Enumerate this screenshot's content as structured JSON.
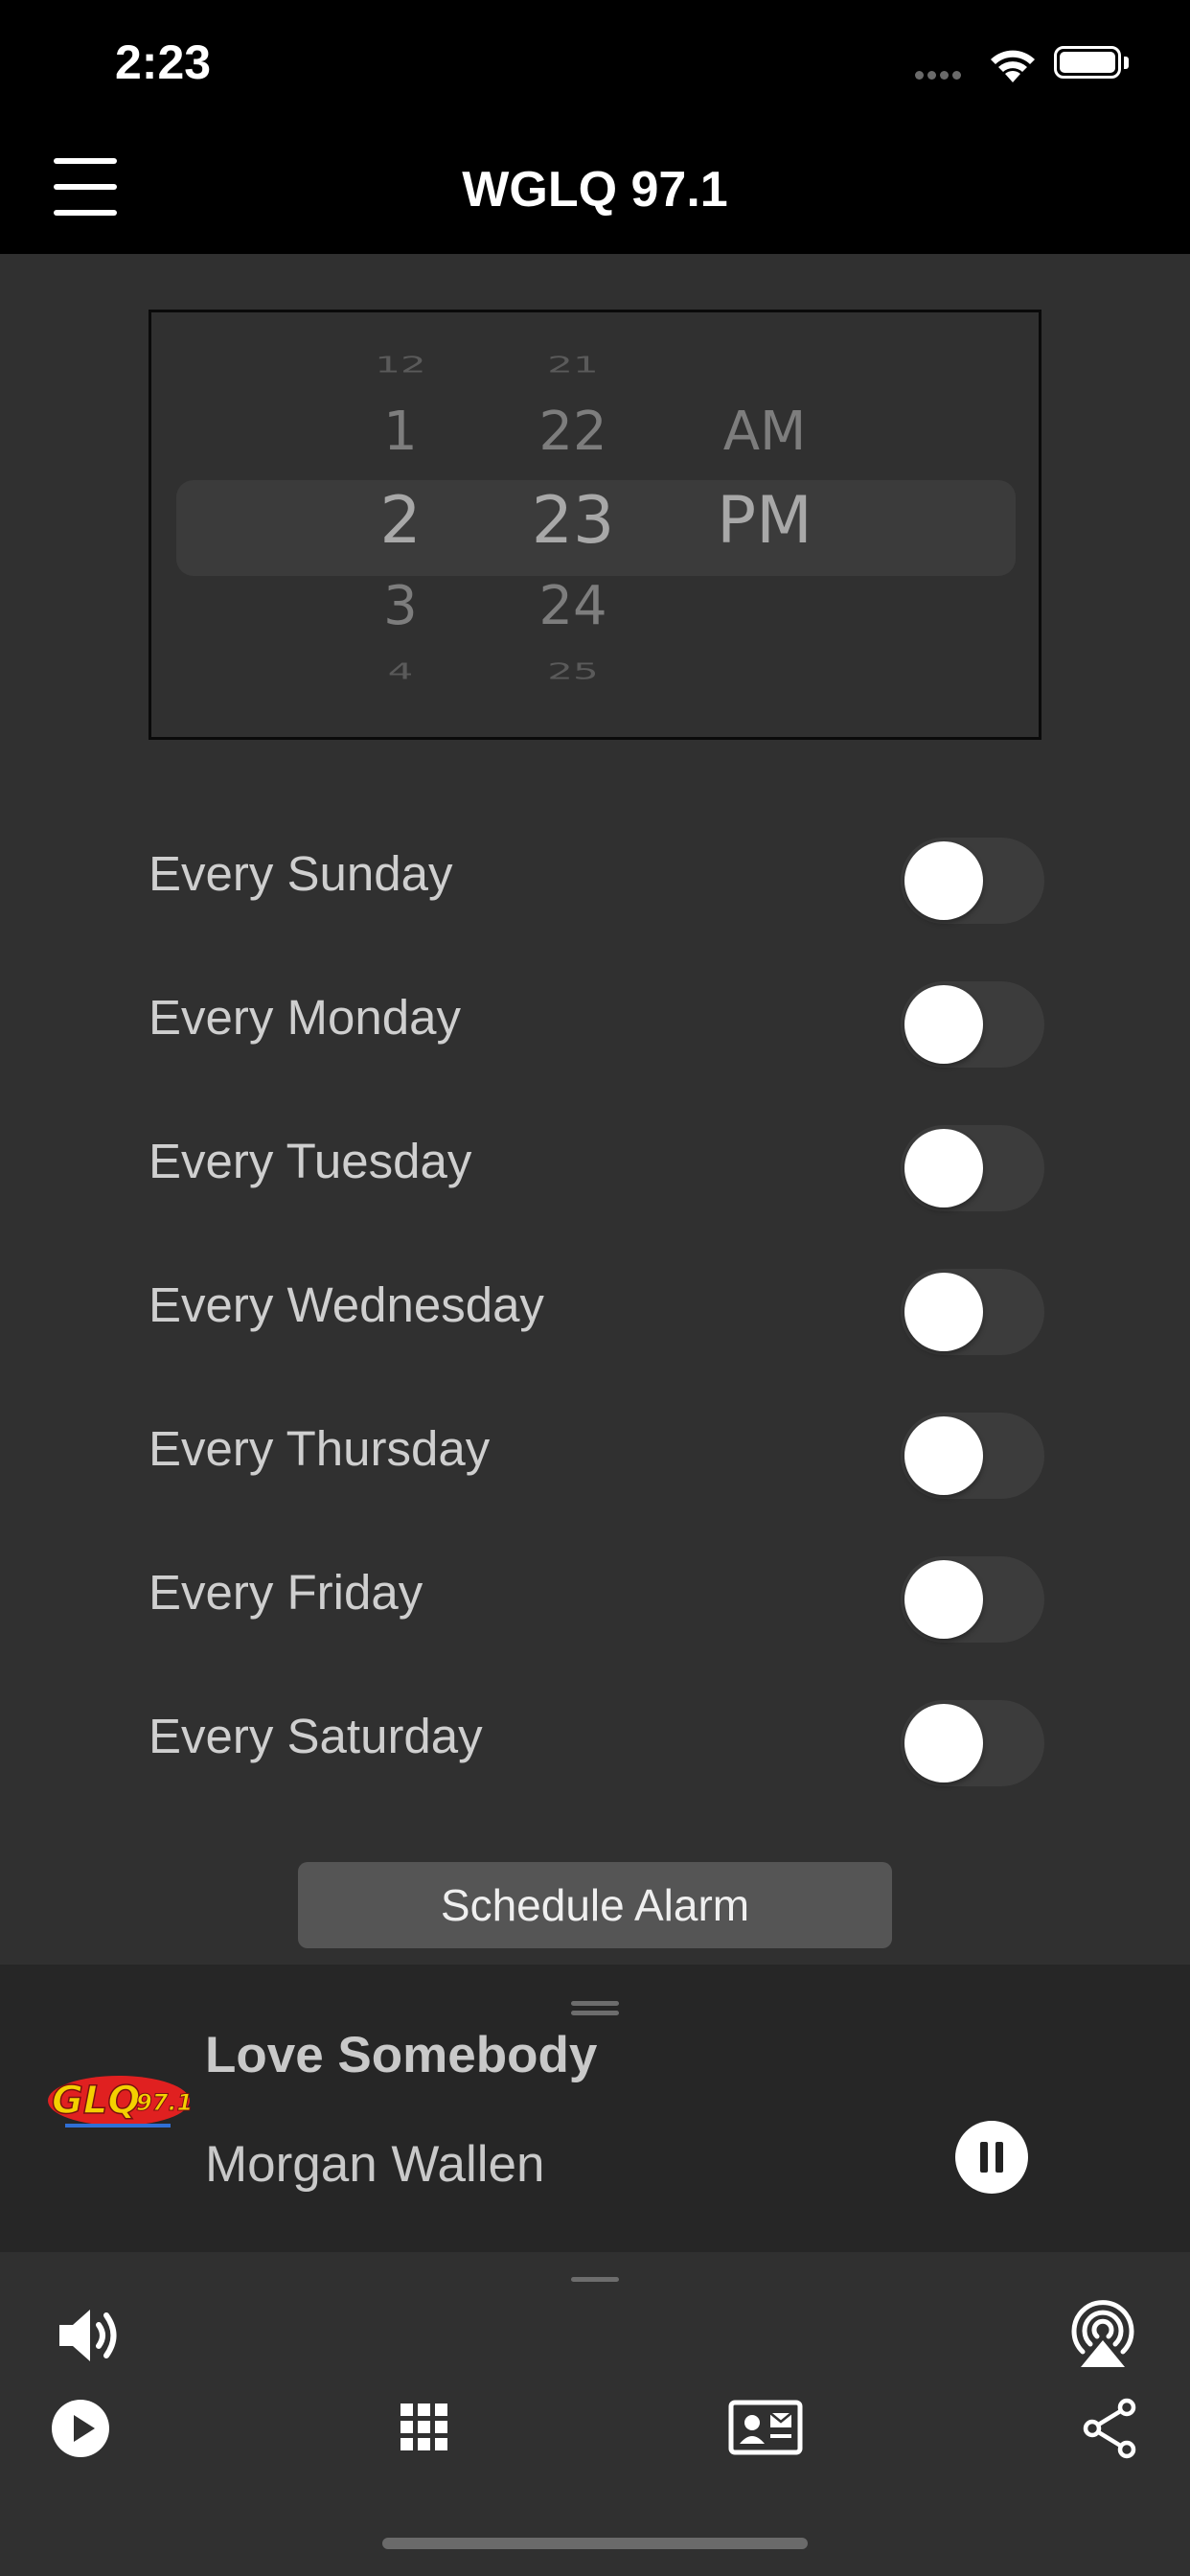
{
  "status_bar": {
    "time": "2:23"
  },
  "header": {
    "title": "WGLQ 97.1"
  },
  "time_picker": {
    "hour": {
      "far_above": "12",
      "above": "1",
      "selected": "2",
      "below": "3",
      "far_below": "4"
    },
    "minute": {
      "far_above": "21",
      "above": "22",
      "selected": "23",
      "below": "24",
      "far_below": "25"
    },
    "period": {
      "above": "AM",
      "selected": "PM"
    }
  },
  "repeat_days": [
    {
      "label": "Every Sunday",
      "enabled": false
    },
    {
      "label": "Every Monday",
      "enabled": false
    },
    {
      "label": "Every Tuesday",
      "enabled": false
    },
    {
      "label": "Every Wednesday",
      "enabled": false
    },
    {
      "label": "Every Thursday",
      "enabled": false
    },
    {
      "label": "Every Friday",
      "enabled": false
    },
    {
      "label": "Every Saturday",
      "enabled": false
    }
  ],
  "schedule_button": {
    "label": "Schedule Alarm"
  },
  "now_playing": {
    "title": "Love Somebody",
    "artist": "Morgan Wallen",
    "station_logo_text": "GLQ 97.1",
    "state_icon": "pause-icon"
  },
  "toolbar": {
    "icons": [
      "volume-icon",
      "airplay-icon",
      "play-icon",
      "grid-icon",
      "contact-card-icon",
      "share-icon"
    ]
  },
  "colors": {
    "background": "#303030",
    "bar": "#000000",
    "player": "#262626",
    "toggle_off": "#3c3c3c"
  }
}
